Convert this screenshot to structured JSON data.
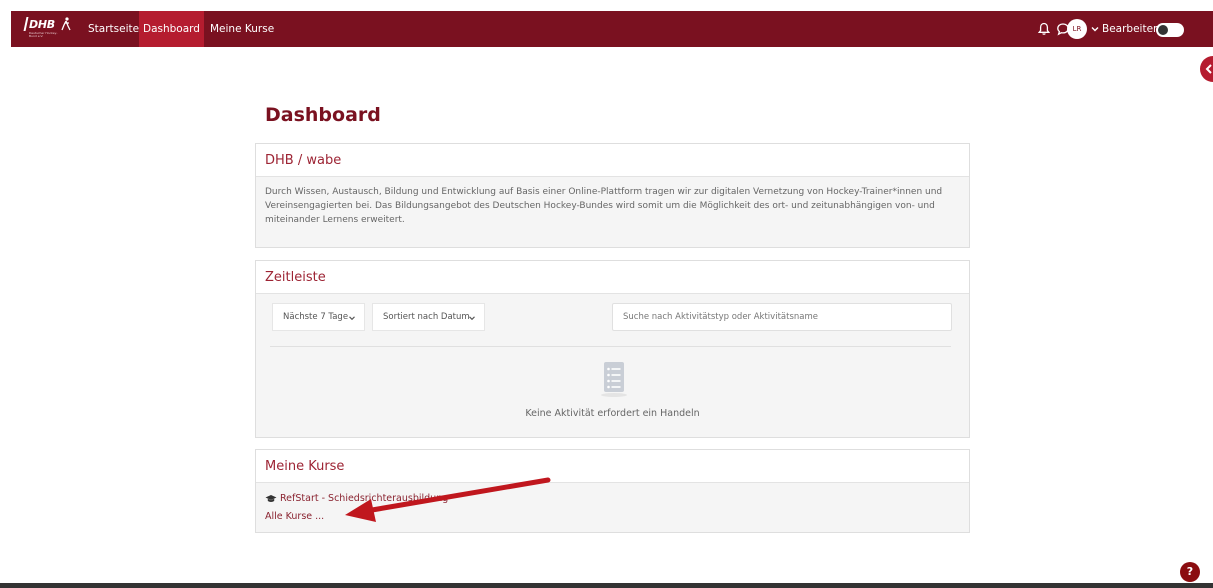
{
  "navbar": {
    "logo_text": "DHB",
    "logo_sub": "Deutscher Hockey-Bund e.V.",
    "links": [
      "Startseite",
      "Dashboard",
      "Meine Kurse"
    ],
    "active_link": "Dashboard",
    "avatar_initials": "LR",
    "edit_label": "Bearbeiten",
    "color_bg": "#7a1120",
    "color_active": "#b51c2f"
  },
  "page": {
    "title": "Dashboard"
  },
  "intro_block": {
    "title": "DHB / wabe",
    "text": "Durch Wissen, Austausch, Bildung und Entwicklung auf Basis einer Online-Plattform tragen wir zur digitalen Vernetzung von Hockey-Trainer*innen und Vereinsengagierten bei. Das Bildungsangebot des Deutschen Hockey-Bundes wird somit um die Möglichkeit des ort- und zeitunabhängigen von- und miteinander Lernens erweitert."
  },
  "timeline": {
    "title": "Zeitleiste",
    "filter_label": "Nächste 7 Tage",
    "sort_label": "Sortiert nach Datum",
    "search_placeholder": "Suche nach Aktivitätstyp oder Aktivitätsname",
    "empty_text": "Keine Aktivität erfordert ein Handeln"
  },
  "courses": {
    "title": "Meine Kurse",
    "course_name": "RefStart - Schiedsrichterausbildung",
    "all_courses": "Alle Kurse ..."
  },
  "help_label": "?"
}
